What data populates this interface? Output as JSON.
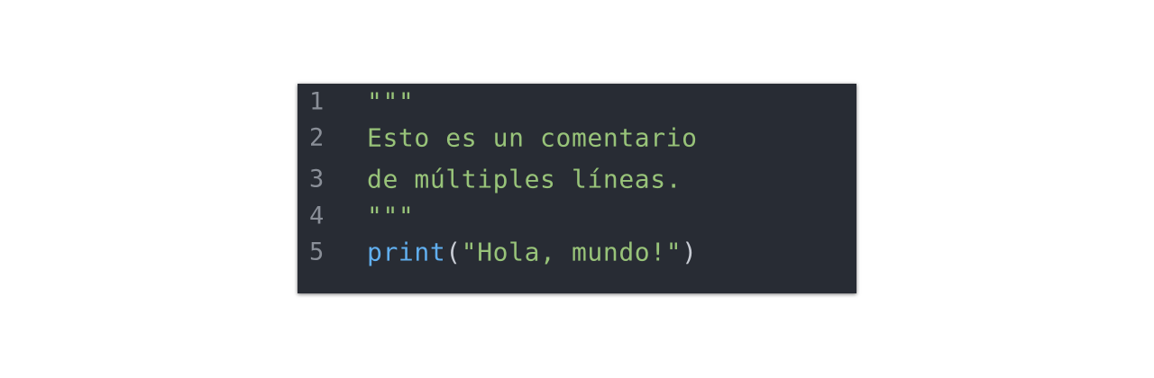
{
  "editor": {
    "lines": [
      {
        "number": "1",
        "text": "\"\"\""
      },
      {
        "number": "2",
        "text": "Esto es un comentario"
      },
      {
        "number": "3",
        "text": "de múltiples líneas."
      },
      {
        "number": "4",
        "text": "\"\"\""
      },
      {
        "number": "5",
        "fn": "print",
        "open": "(",
        "arg": "\"Hola, mundo!\"",
        "close": ")"
      }
    ]
  },
  "colors": {
    "background": "#282c34",
    "line_number": "#8a8f98",
    "string": "#98c379",
    "function": "#61afef",
    "punctuation": "#c8ccd4"
  }
}
